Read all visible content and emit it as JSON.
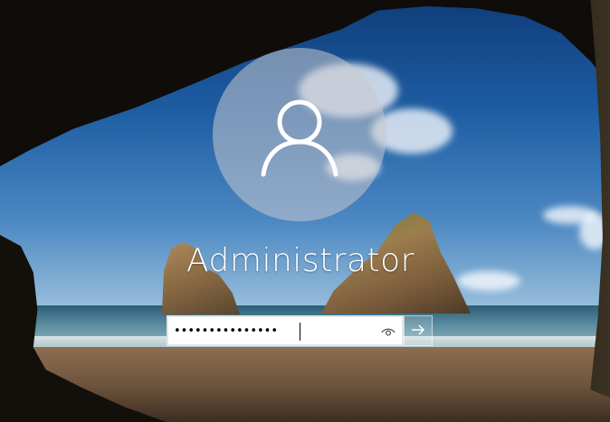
{
  "user": {
    "name": "Administrator",
    "avatar_icon": "user-silhouette-icon"
  },
  "login": {
    "password_value": "•••••••••••••••",
    "reveal_icon": "eye-icon",
    "submit_icon": "arrow-right-icon"
  },
  "colors": {
    "text": "#ffffff",
    "avatar_bg": "#c8c8cd",
    "field_bg": "#ffffff"
  }
}
